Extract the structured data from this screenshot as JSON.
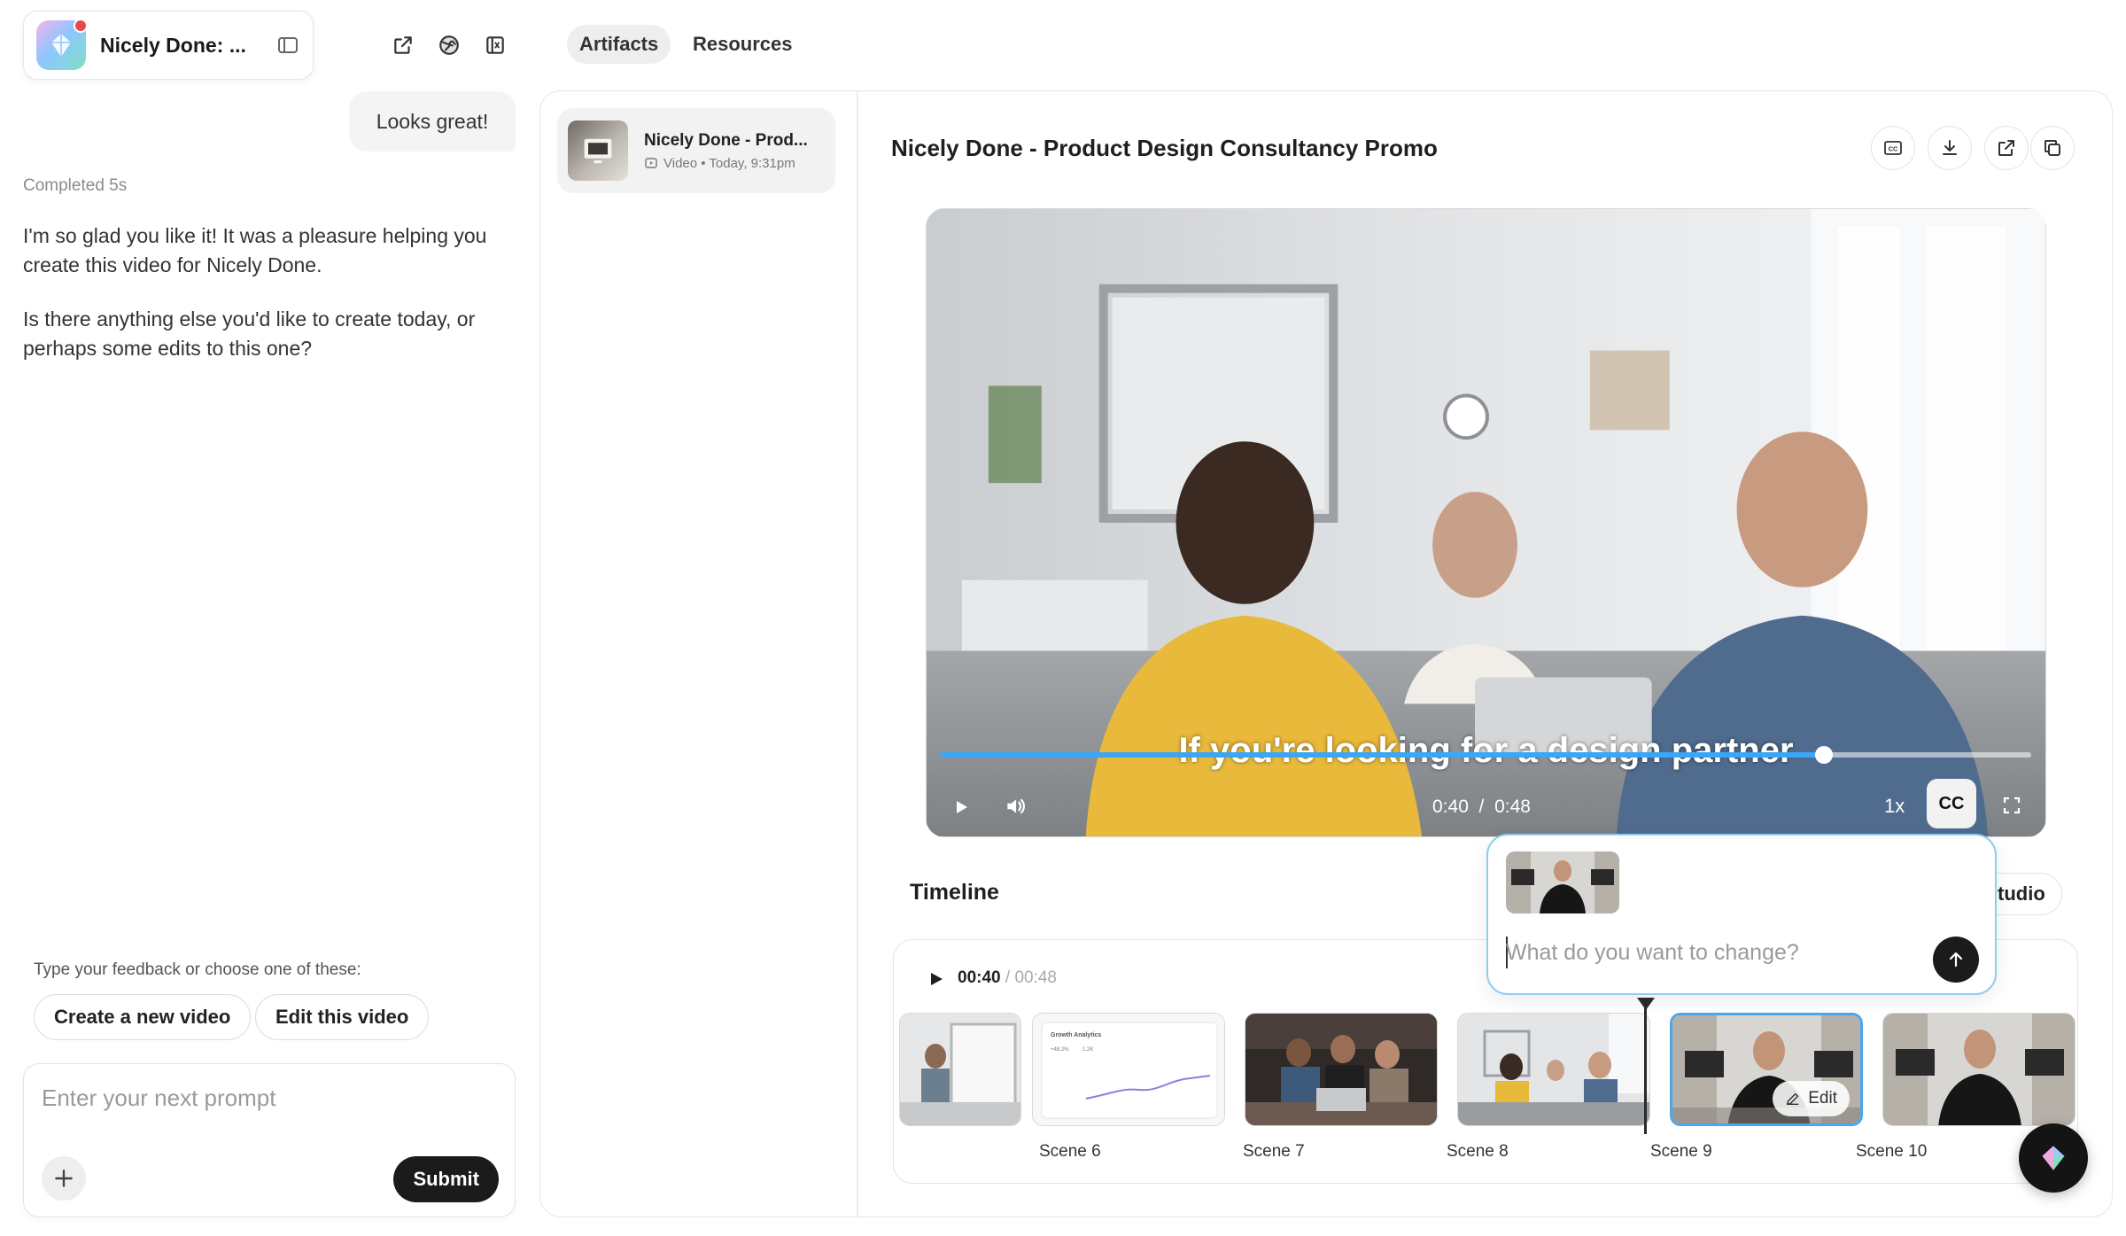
{
  "project": {
    "name": "Nicely Done: ..."
  },
  "chat": {
    "user_message": "Looks great!",
    "status": "Completed 5s",
    "assistant_paragraphs": [
      "I'm so glad you like it! It was a pleasure helping you create this video for Nicely Done.",
      "Is there anything else you'd like to create today, or perhaps some edits to this one?"
    ],
    "feedback_label": "Type your feedback or choose one of these:",
    "suggestions": [
      "Create a new video",
      "Edit this video"
    ],
    "prompt_placeholder": "Enter your next prompt",
    "submit_label": "Submit"
  },
  "tabs": [
    {
      "label": "Artifacts",
      "active": true
    },
    {
      "label": "Resources",
      "active": false
    }
  ],
  "artifact": {
    "title": "Nicely Done - Prod...",
    "meta": "Video • Today, 9:31pm"
  },
  "video": {
    "title": "Nicely Done - Product Design Consultancy Promo",
    "subtitle": "If you're looking for a design partner",
    "current_time": "0:40",
    "separator": "/",
    "duration": "0:48",
    "progress": 0.81,
    "speed": "1x",
    "cc_label": "CC"
  },
  "timeline": {
    "label": "Timeline",
    "studio_label": "tudio",
    "current_time": "00:40",
    "total_time": "/ 00:48",
    "scenes": [
      {
        "label": "",
        "theme": "whiteboard"
      },
      {
        "label": "Scene 6",
        "theme": "chart"
      },
      {
        "label": "Scene 7",
        "theme": "dark-team"
      },
      {
        "label": "Scene 8",
        "theme": "meeting"
      },
      {
        "label": "Scene 9",
        "theme": "presenter",
        "selected": true
      },
      {
        "label": "Scene 10",
        "theme": "presenter"
      }
    ],
    "edit_label": "Edit",
    "scene6_chart_title": "Growth Analytics",
    "scene6_stats": [
      "+48.2%",
      "1.2K"
    ]
  },
  "edit_popover": {
    "placeholder": "What do you want to change?"
  },
  "colors": {
    "accent": "#3aa6f5",
    "popover_border": "#8fcdf2",
    "dark": "#1b1b1b",
    "notification": "#e5484d"
  }
}
